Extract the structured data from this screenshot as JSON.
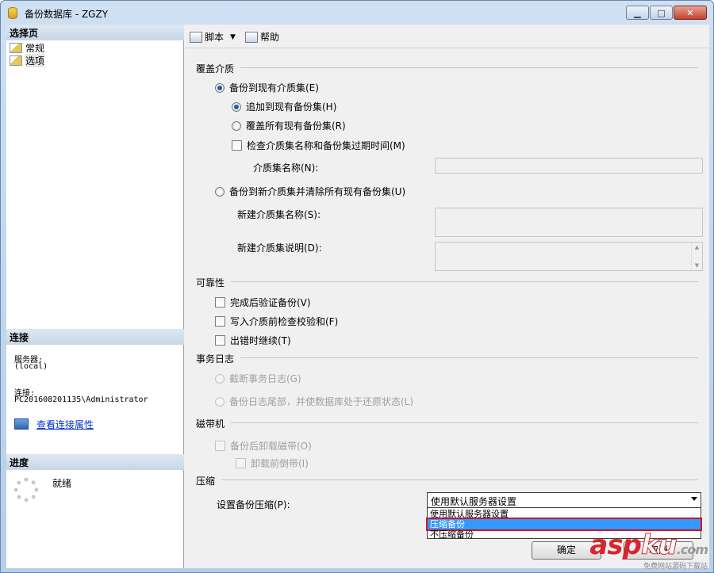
{
  "window": {
    "title": "备份数据库 - ZGZY"
  },
  "left": {
    "select_page_header": "选择页",
    "pages": [
      {
        "label": "常规"
      },
      {
        "label": "选项"
      }
    ],
    "connection_header": "连接",
    "server_label": "服务器:",
    "server_value": "(local)",
    "connection_label": "连接:",
    "connection_value": "PC201608201135\\Administrator",
    "view_connection_link": "查看连接属性",
    "progress_header": "进度",
    "progress_status": "就绪"
  },
  "toolbar": {
    "script_label": "脚本",
    "help_label": "帮助"
  },
  "options": {
    "overwrite_media": {
      "title": "覆盖介质",
      "backup_existing": "备份到现有介质集(E)",
      "append": "追加到现有备份集(H)",
      "overwrite_all": "覆盖所有现有备份集(R)",
      "check_media": "检查介质集名称和备份集过期时间(M)",
      "media_set_name_label": "介质集名称(N):",
      "backup_new": "备份到新介质集并清除所有现有备份集(U)",
      "new_media_set_name_label": "新建介质集名称(S):",
      "new_media_set_desc_label": "新建介质集说明(D):"
    },
    "reliability": {
      "title": "可靠性",
      "verify": "完成后验证备份(V)",
      "checksum": "写入介质前检查校验和(F)",
      "continue_on_error": "出错时继续(T)"
    },
    "transaction_log": {
      "title": "事务日志",
      "truncate": "截断事务日志(G)",
      "tail_log": "备份日志尾部，并使数据库处于还原状态(L)"
    },
    "tape": {
      "title": "磁带机",
      "unload": "备份后卸载磁带(O)",
      "rewind": "卸载前倒带(I)"
    },
    "compression": {
      "title": "压缩",
      "label": "设置备份压缩(P):",
      "selected": "使用默认服务器设置",
      "options": [
        "使用默认服务器设置",
        "压缩备份",
        "不压缩备份"
      ],
      "highlighted_index": 1
    }
  },
  "buttons": {
    "ok": "确定",
    "cancel": "取消"
  },
  "watermark": {
    "logo_a": "asp",
    "logo_b": "ku",
    "logo_c": ".com",
    "sub": "免费网站源码下载站"
  }
}
